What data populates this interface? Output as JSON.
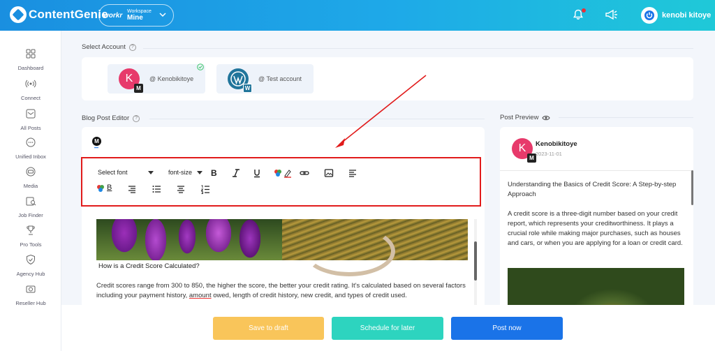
{
  "header": {
    "brand": "ContentGenie",
    "workspace_brand": "workr",
    "workspace_label": "Workspace",
    "workspace_name": "Mine",
    "user_name": "kenobi kitoye",
    "colors": {
      "gradient_start": "#1a8fe0",
      "gradient_end": "#1fc9d8",
      "notification_dot": "#e8303a"
    }
  },
  "sidebar": {
    "items": [
      {
        "label": "Dashboard",
        "icon": "dashboard-grid-icon"
      },
      {
        "label": "Connect",
        "icon": "broadcast-icon"
      },
      {
        "label": "All Posts",
        "icon": "inbox-icon"
      },
      {
        "label": "Unified Inbox",
        "icon": "chat-bubble-icon"
      },
      {
        "label": "Media",
        "icon": "media-icon"
      },
      {
        "label": "Job Finder",
        "icon": "job-search-icon"
      },
      {
        "label": "Pro Tools",
        "icon": "trophy-icon"
      },
      {
        "label": "Agency Hub",
        "icon": "shield-check-icon"
      },
      {
        "label": "Reseller Hub",
        "icon": "camera-icon"
      }
    ]
  },
  "select_account": {
    "label": "Select Account",
    "accounts": [
      {
        "initial": "K",
        "name": "@ Kenobikitoye",
        "platform": "medium",
        "selected": true,
        "color": "#e73a6b"
      },
      {
        "initial": "",
        "name": "@ Test account",
        "platform": "wordpress",
        "selected": false,
        "color": "#21759b"
      }
    ]
  },
  "editor": {
    "label": "Blog Post Editor",
    "platform_badge": "M",
    "toolbar": {
      "font_select": "Select font",
      "size_select": "font-size",
      "bold": "B",
      "bg_bold": "B"
    },
    "caption": "How is a Credit Score Calculated?",
    "paragraph_before": "Credit scores range from 300 to 850, the higher the score, the better your credit rating. It's calculated based on several factors including your payment history, ",
    "paragraph_underlined": "amount",
    "paragraph_after": " owed, length of credit history, new credit, and types of credit used."
  },
  "preview": {
    "label": "Post Preview",
    "initial": "K",
    "badge": "M",
    "author": "Kenobikitoye",
    "date": "2023-11-01",
    "title": "Understanding the Basics of Credit Score: A Step-by-step Approach",
    "body": "A credit score is a three-digit number based on your credit report, which represents your creditworthiness. It plays a crucial role while making major purchases, such as houses and cars, or when you are applying for a loan or credit card."
  },
  "actions": {
    "draft": {
      "label": "Save to draft",
      "color": "#f9c55a"
    },
    "schedule": {
      "label": "Schedule for later",
      "color": "#2dd4bf"
    },
    "post": {
      "label": "Post now",
      "color": "#1a73e8"
    }
  },
  "annotation": {
    "box_color": "#e11b1b"
  }
}
